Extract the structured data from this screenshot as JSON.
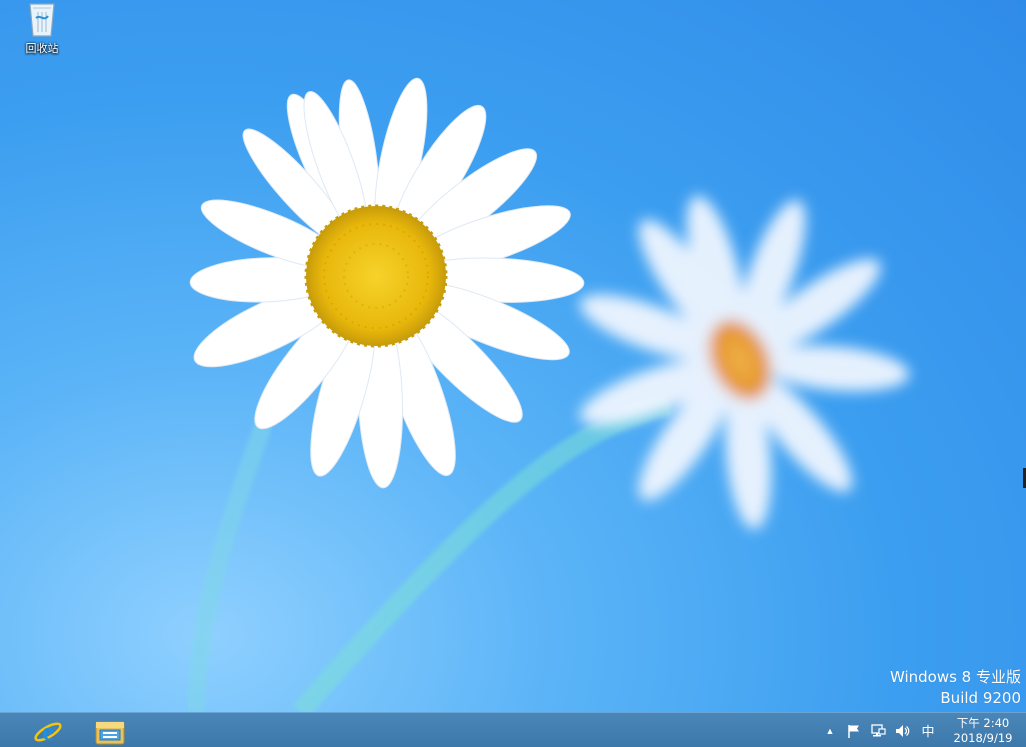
{
  "desktop": {
    "icons": [
      {
        "label": "回收站",
        "icon": "recycle-bin-icon"
      }
    ],
    "watermark": {
      "line1": "Windows 8 专业版",
      "line2": "Build 9200"
    }
  },
  "taskbar": {
    "pinned": [
      {
        "name": "Internet Explorer",
        "icon": "ie-icon"
      },
      {
        "name": "File Explorer",
        "icon": "folder-icon"
      }
    ],
    "tray": {
      "show_hidden": "▲",
      "ime": "中"
    },
    "clock": {
      "time": "下午 2:40",
      "date": "2018/9/19"
    }
  },
  "colors": {
    "sky": "#3c9ef0",
    "taskbar": "#4281b4",
    "petal": "#ffffff",
    "center": "#f1c10a"
  }
}
